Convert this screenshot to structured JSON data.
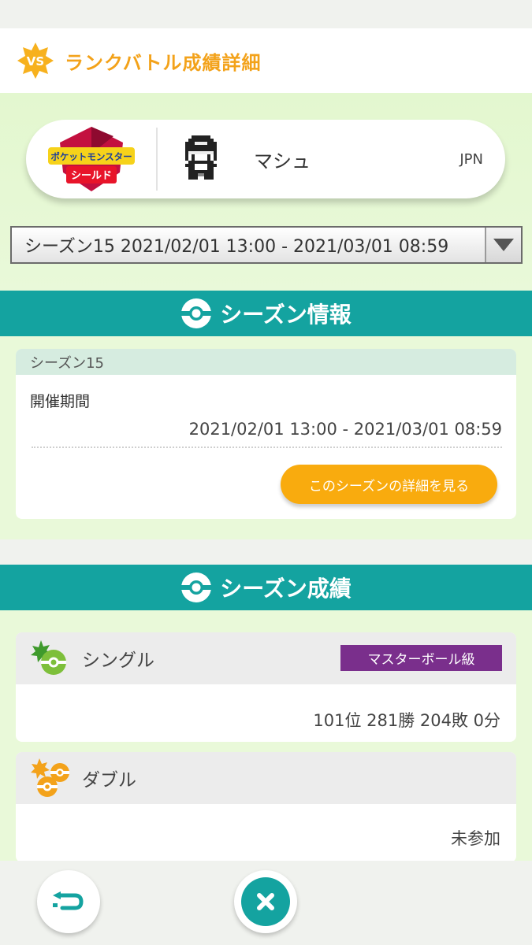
{
  "header": {
    "title": "ランクバトル成績詳細",
    "badge_text": "VS"
  },
  "profile": {
    "game_logo_text": [
      "ポケットモンスター",
      "シールド"
    ],
    "player_name": "マシュ",
    "region": "JPN"
  },
  "season_select": {
    "selected": "シーズン15 2021/02/01 13:00 - 2021/03/01 08:59"
  },
  "season_info": {
    "section_title": "シーズン情報",
    "season_name": "シーズン15",
    "period_label": "開催期間",
    "period_value": "2021/02/01 13:00 - 2021/03/01 08:59",
    "detail_button": "このシーズンの詳細を見る"
  },
  "season_results": {
    "section_title": "シーズン成績",
    "single": {
      "label": "シングル",
      "rank_badge": "マスターボール級",
      "value": "101位 281勝 204敗 0分"
    },
    "double": {
      "label": "ダブル",
      "value": "未参加"
    }
  },
  "colors": {
    "accent_orange": "#f3a21a",
    "teal": "#14a3a0",
    "master_purple": "#7a2f8c",
    "button_orange": "#f9ab0e"
  },
  "icons": {
    "header": "vs-badge-icon",
    "avatar": "pixel-trainer-avatar",
    "section": "pokeball-icon",
    "select": "dropdown-arrow-icon",
    "single": "single-battle-icon",
    "double": "double-battle-icon",
    "back": "back-arrow-icon",
    "close": "close-icon"
  }
}
